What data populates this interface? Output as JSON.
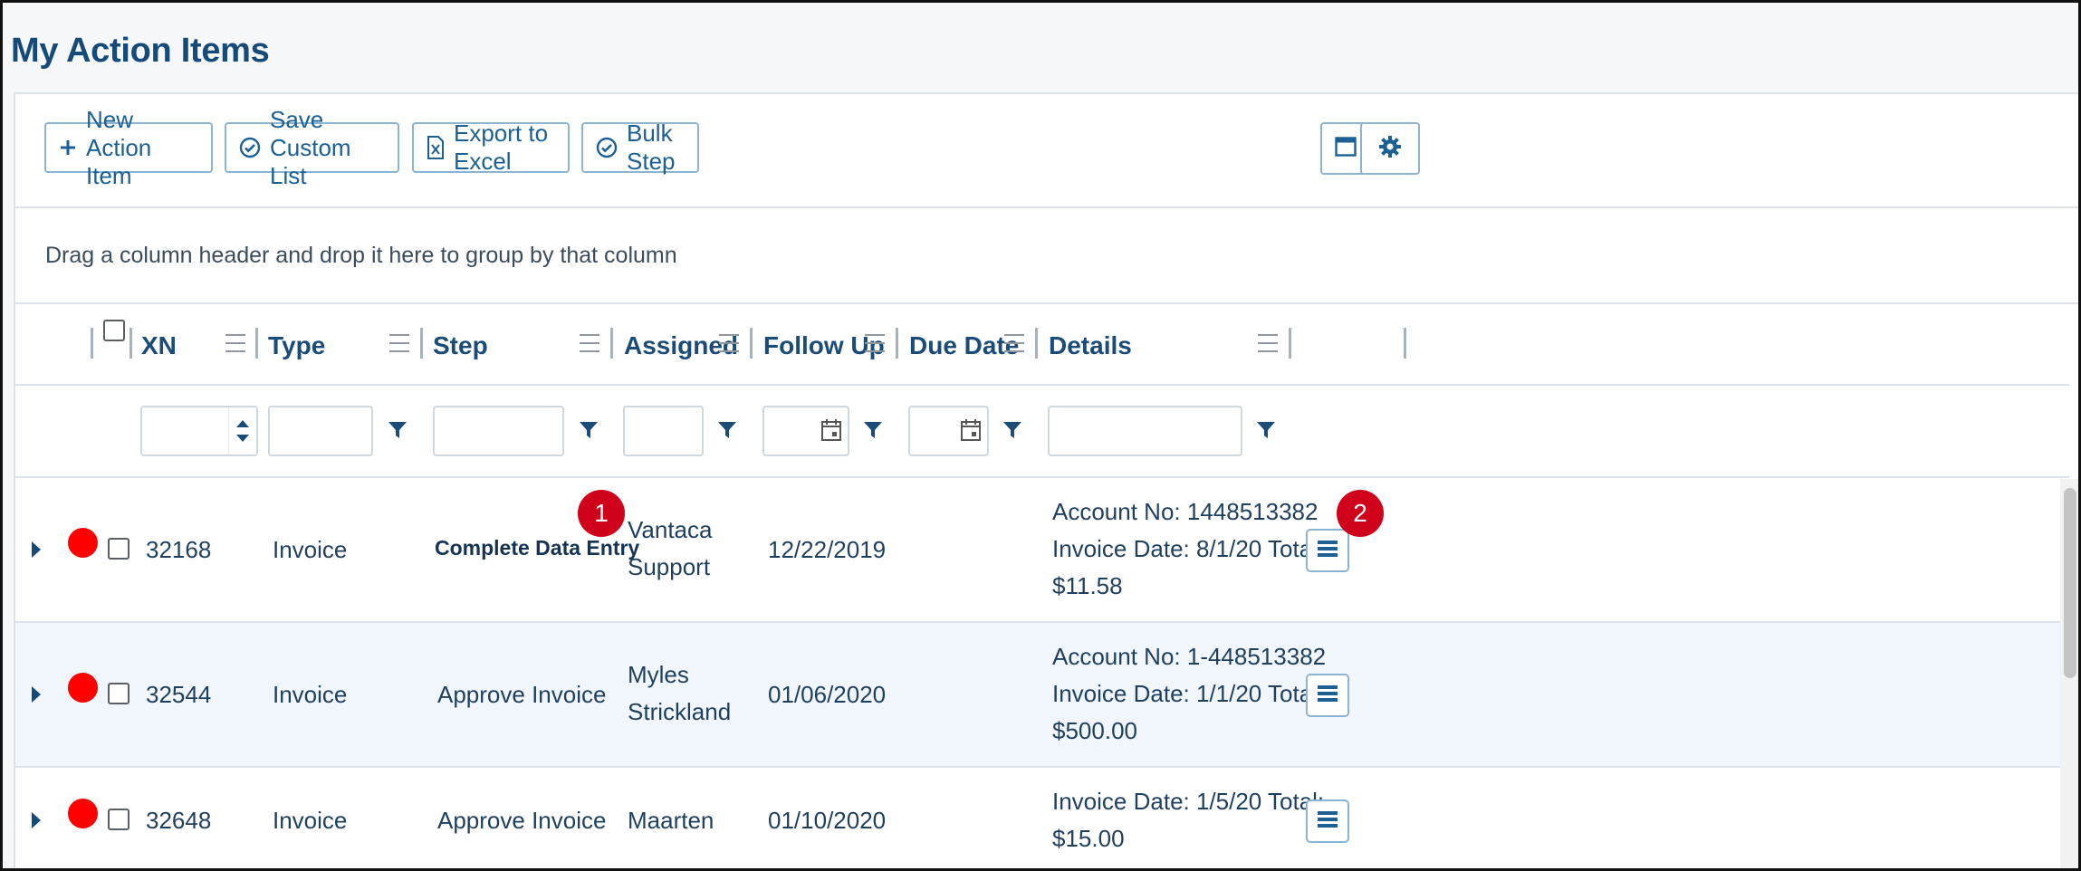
{
  "page": {
    "title": "My Action Items"
  },
  "toolbar": {
    "new_label": "New Action Item",
    "save_label": "Save Custom List",
    "export_label": "Export to Excel",
    "bulk_label": "Bulk Step"
  },
  "group_hint": "Drag a column header and drop it here to group by that column",
  "columns": {
    "xn": "XN",
    "type": "Type",
    "step": "Step",
    "assigned": "Assigned",
    "follow_up": "Follow Up",
    "due_date": "Due Date",
    "details": "Details"
  },
  "rows": [
    {
      "xn": "32168",
      "type": "Invoice",
      "step": "Complete Data Entry",
      "assigned": [
        "Vantaca",
        "Support"
      ],
      "follow_up": "12/22/2019",
      "due_date": "",
      "details": [
        "Account No: 1448513382",
        "Invoice Date: 8/1/20 Total:",
        "$11.58"
      ]
    },
    {
      "xn": "32544",
      "type": "Invoice",
      "step": "Approve Invoice",
      "assigned": [
        "Myles",
        "Strickland"
      ],
      "follow_up": "01/06/2020",
      "due_date": "",
      "details": [
        "Account No: 1-448513382",
        "Invoice Date: 1/1/20 Total:",
        "$500.00"
      ]
    },
    {
      "xn": "32648",
      "type": "Invoice",
      "step": "Approve Invoice",
      "assigned": [
        "Maarten"
      ],
      "follow_up": "01/10/2020",
      "due_date": "",
      "details": [
        "Invoice Date: 1/5/20 Total:",
        "$15.00"
      ]
    }
  ],
  "badges": {
    "one": "1",
    "two": "2"
  },
  "colors": {
    "accent": "#1b5f93",
    "title": "#164a78",
    "status_dot": "#ff0000",
    "badge": "#d0021b",
    "alt_row": "#f0f6fb"
  },
  "icons": [
    "plus-icon",
    "check-circle-icon",
    "excel-icon",
    "window-icon",
    "gear-icon",
    "sort-arrows-icon",
    "funnel-icon",
    "calendar-icon",
    "list-icon",
    "expand-caret-icon"
  ]
}
